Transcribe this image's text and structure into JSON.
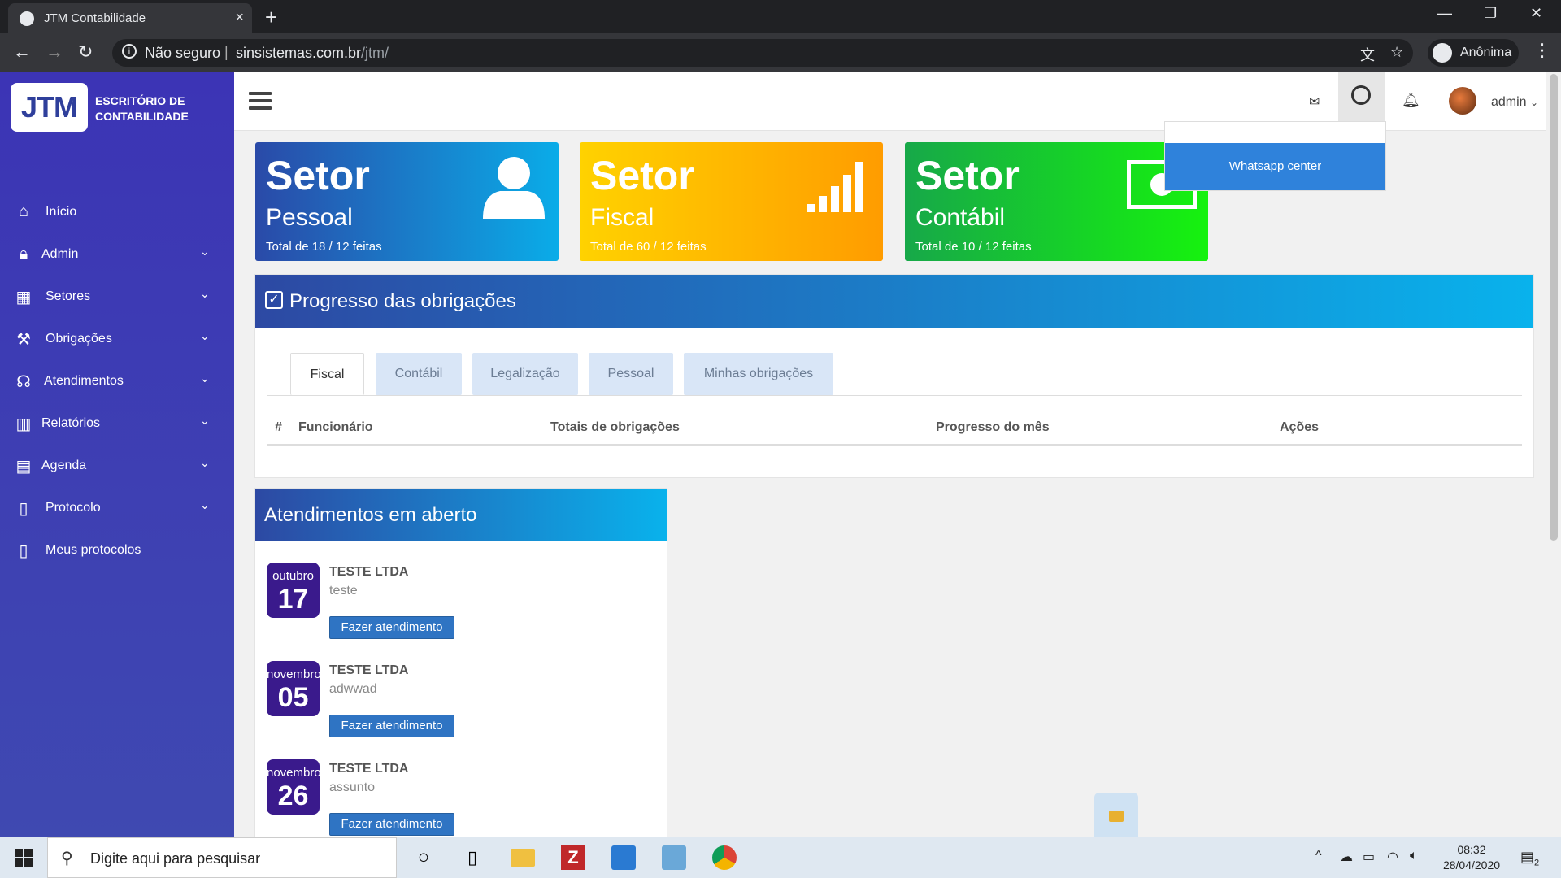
{
  "browser": {
    "tab_title": "JTM Contabilidade",
    "tab_close": "×",
    "new_tab": "+",
    "security_label": "Não seguro",
    "url_host": "sinsistemas.com.br",
    "url_path": "/jtm/",
    "profile_label": "Anônima"
  },
  "brand": {
    "logo_text": "JTM",
    "line1": "ESCRITÓRIO DE",
    "line2": "CONTABILIDADE"
  },
  "sidebar": {
    "items": [
      {
        "label": "Início",
        "icon": "home-icon"
      },
      {
        "label": "Admin",
        "icon": "lock-icon"
      },
      {
        "label": "Setores",
        "icon": "building-icon"
      },
      {
        "label": "Obrigações",
        "icon": "gavel-icon"
      },
      {
        "label": "Atendimentos",
        "icon": "headset-icon"
      },
      {
        "label": "Relatórios",
        "icon": "chart-icon"
      },
      {
        "label": "Agenda",
        "icon": "book-icon"
      },
      {
        "label": "Protocolo",
        "icon": "file-icon"
      },
      {
        "label": "Meus protocolos",
        "icon": "file-icon"
      }
    ]
  },
  "header": {
    "user_label": "admin",
    "dropdown_item": "Whatsapp center"
  },
  "cards": [
    {
      "title": "Setor",
      "subtitle": "Pessoal",
      "total": "Total de 18 / 12 feitas",
      "color_from": "#2a4aa8",
      "color_to": "#0aace8"
    },
    {
      "title": "Setor",
      "subtitle": "Fiscal",
      "total": "Total de 60 / 12 feitas",
      "color_from": "#ffd200",
      "color_to": "#ff9c00"
    },
    {
      "title": "Setor",
      "subtitle": "Contábil",
      "total": "Total de 10 / 12 feitas",
      "color_from": "#17a849",
      "color_to": "#16f20e"
    }
  ],
  "progress_panel": {
    "title": "Progresso das obrigações",
    "tabs": [
      "Fiscal",
      "Contábil",
      "Legalização",
      "Pessoal",
      "Minhas obrigações"
    ],
    "active_tab": "Fiscal",
    "columns": [
      "#",
      "Funcionário",
      "Totais de obrigações",
      "Progresso do mês",
      "Ações"
    ]
  },
  "attendance_panel": {
    "title": "Atendimentos em aberto",
    "items": [
      {
        "month": "outubro",
        "day": "17",
        "company": "TESTE LTDA",
        "subject": "teste",
        "button": "Fazer atendimento"
      },
      {
        "month": "novembro",
        "day": "05",
        "company": "TESTE LTDA",
        "subject": "adwwad",
        "button": "Fazer atendimento"
      },
      {
        "month": "novembro",
        "day": "26",
        "company": "TESTE LTDA",
        "subject": "assunto",
        "button": "Fazer atendimento"
      }
    ]
  },
  "taskbar": {
    "search_placeholder": "Digite aqui para pesquisar",
    "time": "08:32",
    "date": "28/04/2020",
    "notifications": "2"
  }
}
